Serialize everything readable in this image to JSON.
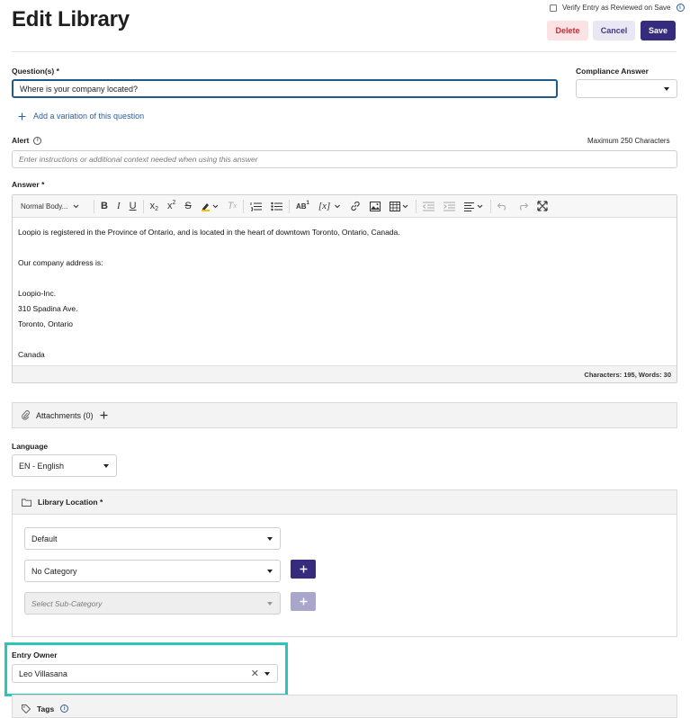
{
  "header": {
    "title": "Edit Library",
    "verify_label": "Verify Entry as Reviewed on Save",
    "delete_label": "Delete",
    "cancel_label": "Cancel",
    "save_label": "Save"
  },
  "questions": {
    "label": "Question(s) *",
    "value": "Where is your company located?",
    "add_variation": "Add a variation of this question"
  },
  "compliance": {
    "label": "Compliance Answer",
    "value": ""
  },
  "alert": {
    "label": "Alert",
    "max_chars": "Maximum 250 Characters",
    "placeholder": "Enter instructions or additional context needed when using this answer"
  },
  "answer": {
    "label": "Answer *",
    "toolbar": {
      "paragraph_style": "Normal Body..."
    },
    "lines": [
      "Loopio is registered in the Province of Ontario, and is located in the heart of downtown Toronto, Ontario, Canada.",
      "",
      "Our company address is:",
      "",
      "Loopio-Inc.",
      "310 Spadina Ave.",
      "Toronto, Ontario",
      "",
      "Canada"
    ],
    "counts": "Characters: 195, Words: 30"
  },
  "attachments": {
    "label": "Attachments (0)"
  },
  "language": {
    "label": "Language",
    "value": "EN - English"
  },
  "library_location": {
    "label": "Library Location *",
    "stack": "Default",
    "category": "No Category",
    "subcategory_placeholder": "Select Sub-Category"
  },
  "entry_owner": {
    "label": "Entry Owner",
    "value": "Leo Villasana"
  },
  "tags": {
    "label": "Tags"
  },
  "colors": {
    "primary": "#352c7d",
    "delete": "#c0303a",
    "link": "#2c5e9e",
    "highlight": "#2ac7b7",
    "focus": "#1e5b8a"
  },
  "icons": [
    "info-icon",
    "plus-icon",
    "paperclip-icon",
    "folder-icon",
    "tag-icon",
    "chevron-down-icon",
    "clear-icon"
  ]
}
